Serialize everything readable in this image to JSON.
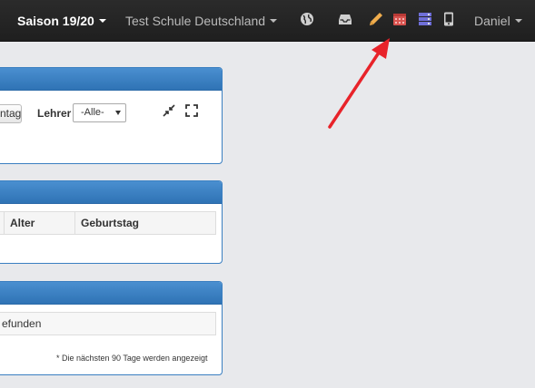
{
  "navbar": {
    "season": "Saison 19/20",
    "school": "Test Schule Deutschland",
    "user": "Daniel",
    "icons": [
      "globe-icon",
      "inbox-icon",
      "pencil-icon",
      "calendar-icon",
      "server-icon",
      "mobile-icon"
    ],
    "colors": {
      "background": "#232323",
      "text": "#ffffff",
      "pencil": "#f0ad4e",
      "calendar": "#d9534f",
      "server": "#6f6fd8"
    }
  },
  "filter_panel": {
    "button_label": "ntag",
    "teacher_label": "Lehrer",
    "teacher_select": "-Alle-",
    "icons": [
      "compress-icon",
      "expand-icon"
    ]
  },
  "birthday_table": {
    "columns": [
      "Alter",
      "Geburtstag"
    ]
  },
  "result_panel": {
    "message": "efunden",
    "footnote": "* Die nächsten 90 Tage werden angezeigt"
  },
  "accent_color": "#3a7fc1",
  "annotation_color": "#e8232a"
}
